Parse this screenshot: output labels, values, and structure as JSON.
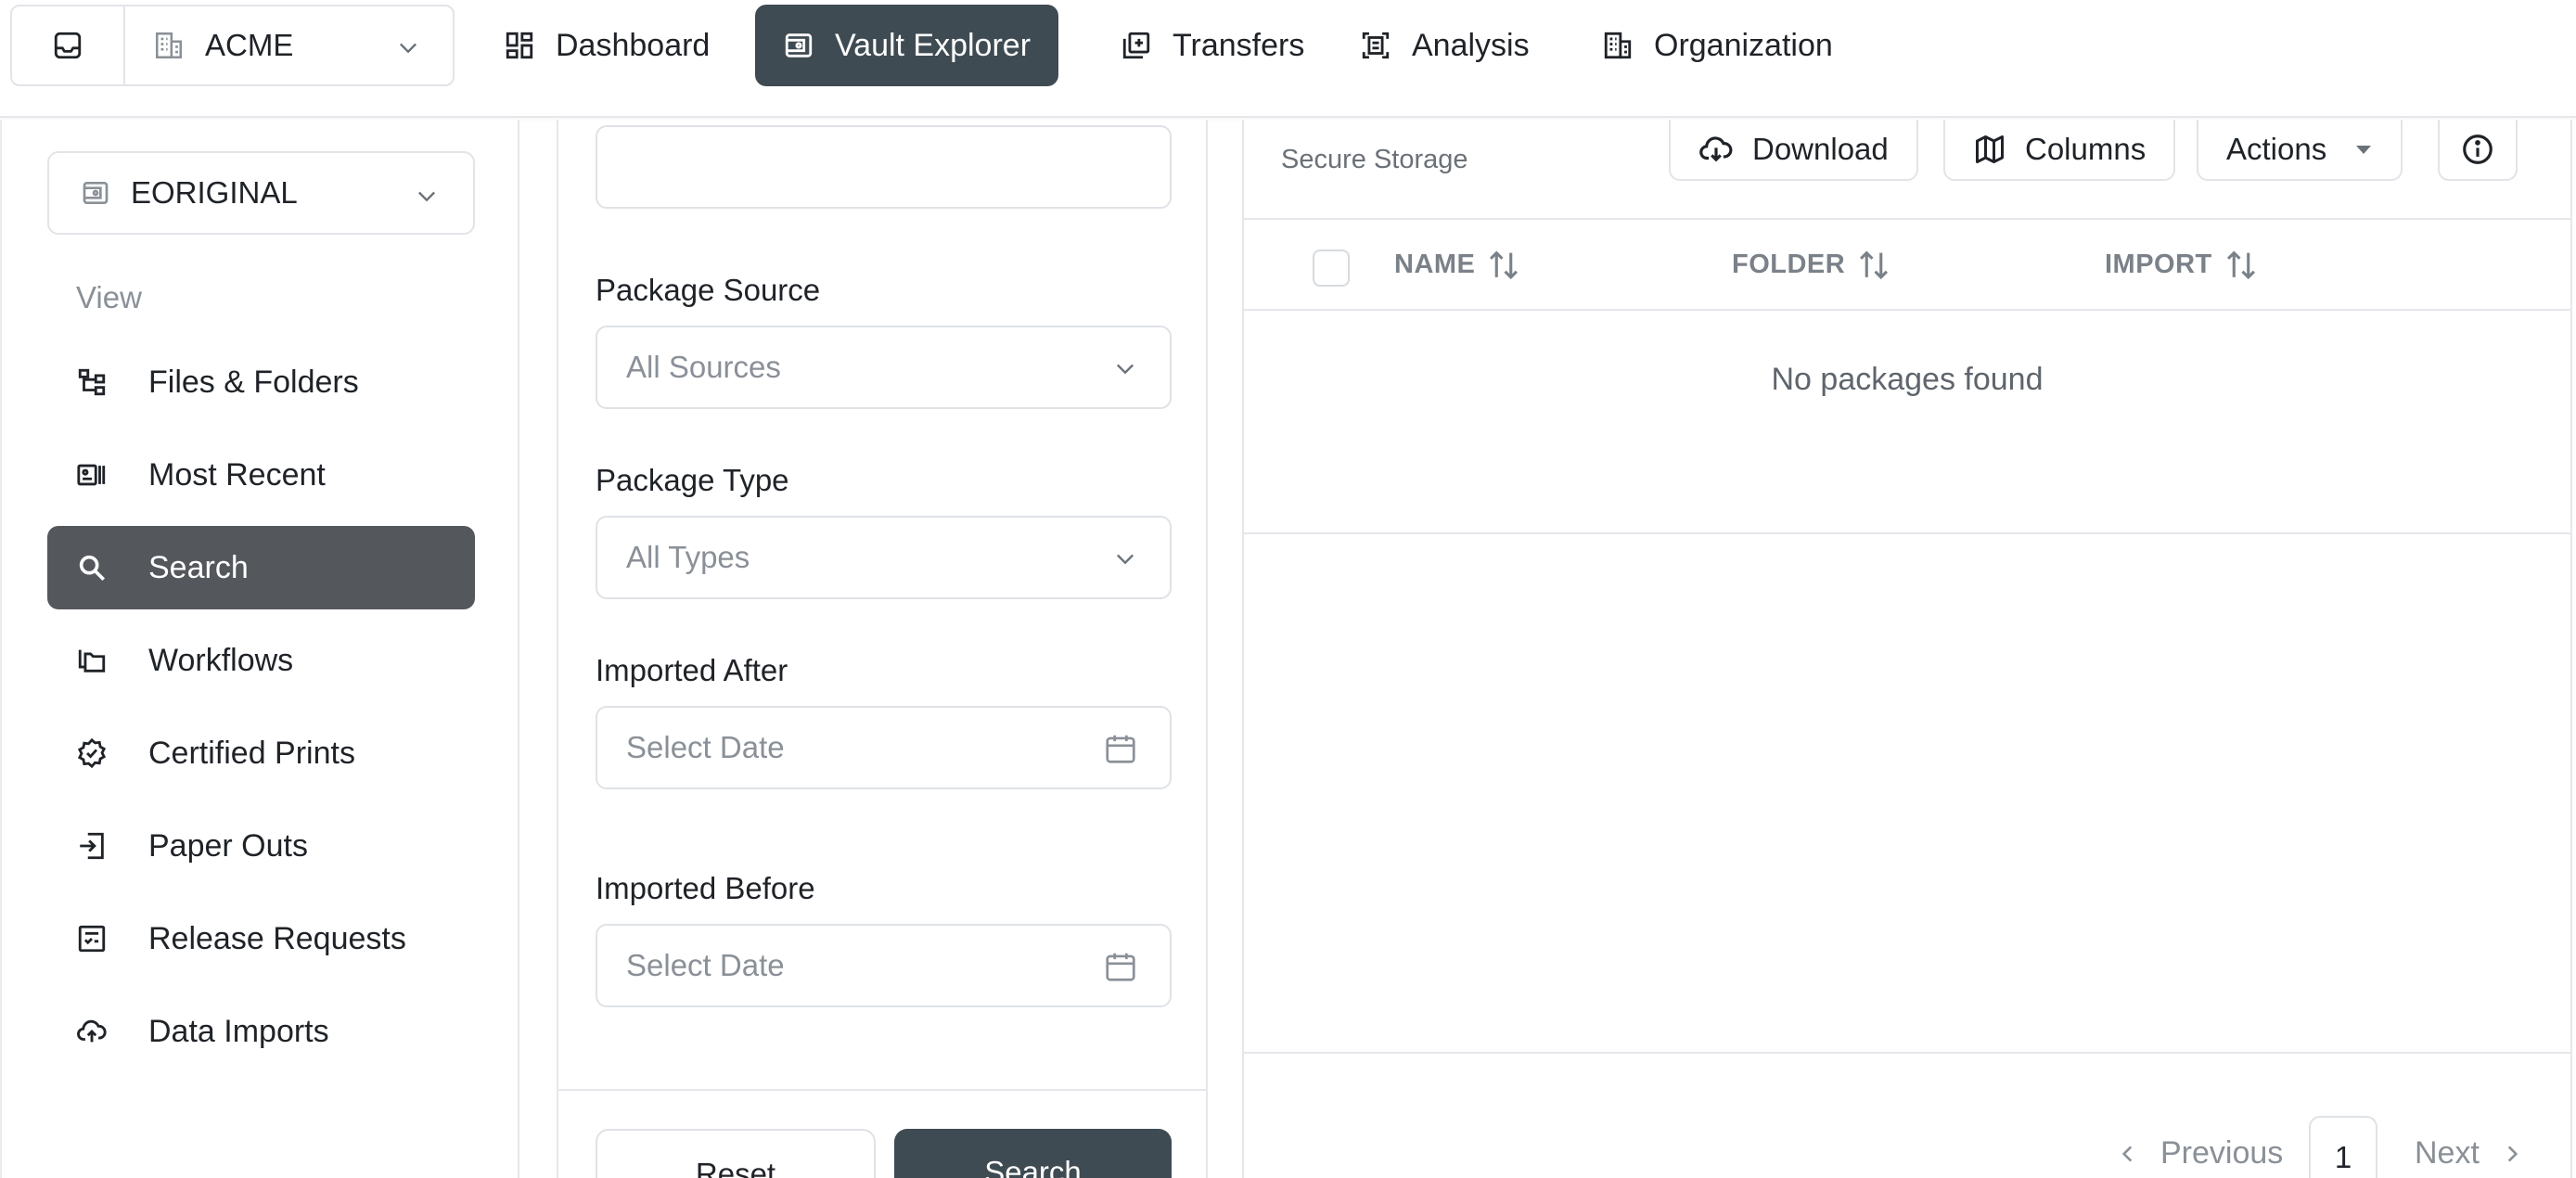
{
  "topbar": {
    "org_name": "ACME",
    "tabs": [
      {
        "label": "Dashboard",
        "icon": "dashboard-icon"
      },
      {
        "label": "Vault Explorer",
        "icon": "vault-icon",
        "active": true
      },
      {
        "label": "Transfers",
        "icon": "transfers-icon"
      },
      {
        "label": "Analysis",
        "icon": "analysis-icon"
      },
      {
        "label": "Organization",
        "icon": "organization-icon"
      }
    ]
  },
  "sidebar": {
    "vault_name": "EORIGINAL",
    "view_label": "View",
    "items": [
      {
        "label": "Files & Folders",
        "icon": "folder-tree-icon"
      },
      {
        "label": "Most Recent",
        "icon": "recent-icon"
      },
      {
        "label": "Search",
        "icon": "search-icon",
        "active": true
      },
      {
        "label": "Workflows",
        "icon": "workflows-icon"
      },
      {
        "label": "Certified Prints",
        "icon": "certified-badge-icon"
      },
      {
        "label": "Paper Outs",
        "icon": "paper-out-icon"
      },
      {
        "label": "Release Requests",
        "icon": "release-request-icon"
      },
      {
        "label": "Data Imports",
        "icon": "cloud-upload-icon"
      }
    ]
  },
  "filters": {
    "top_input_value": "",
    "package_source": {
      "label": "Package Source",
      "value": "All Sources"
    },
    "package_type": {
      "label": "Package Type",
      "value": "All Types"
    },
    "imported_after": {
      "label": "Imported After",
      "placeholder": "Select Date"
    },
    "imported_before": {
      "label": "Imported Before",
      "placeholder": "Select Date"
    },
    "reset_label": "Reset",
    "search_label": "Search"
  },
  "results": {
    "subtitle": "Secure Storage",
    "toolbar": {
      "download_label": "Download",
      "columns_label": "Columns",
      "actions_label": "Actions"
    },
    "columns": [
      "NAME",
      "FOLDER",
      "IMPORT"
    ],
    "empty_message": "No packages found",
    "pagination": {
      "prev_label": "Previous",
      "page": "1",
      "next_label": "Next"
    }
  },
  "colors": {
    "accent": "#3f4b53",
    "sidebar_active": "#54575c",
    "border": "#e2e4e8",
    "muted_text": "#8a9097"
  }
}
